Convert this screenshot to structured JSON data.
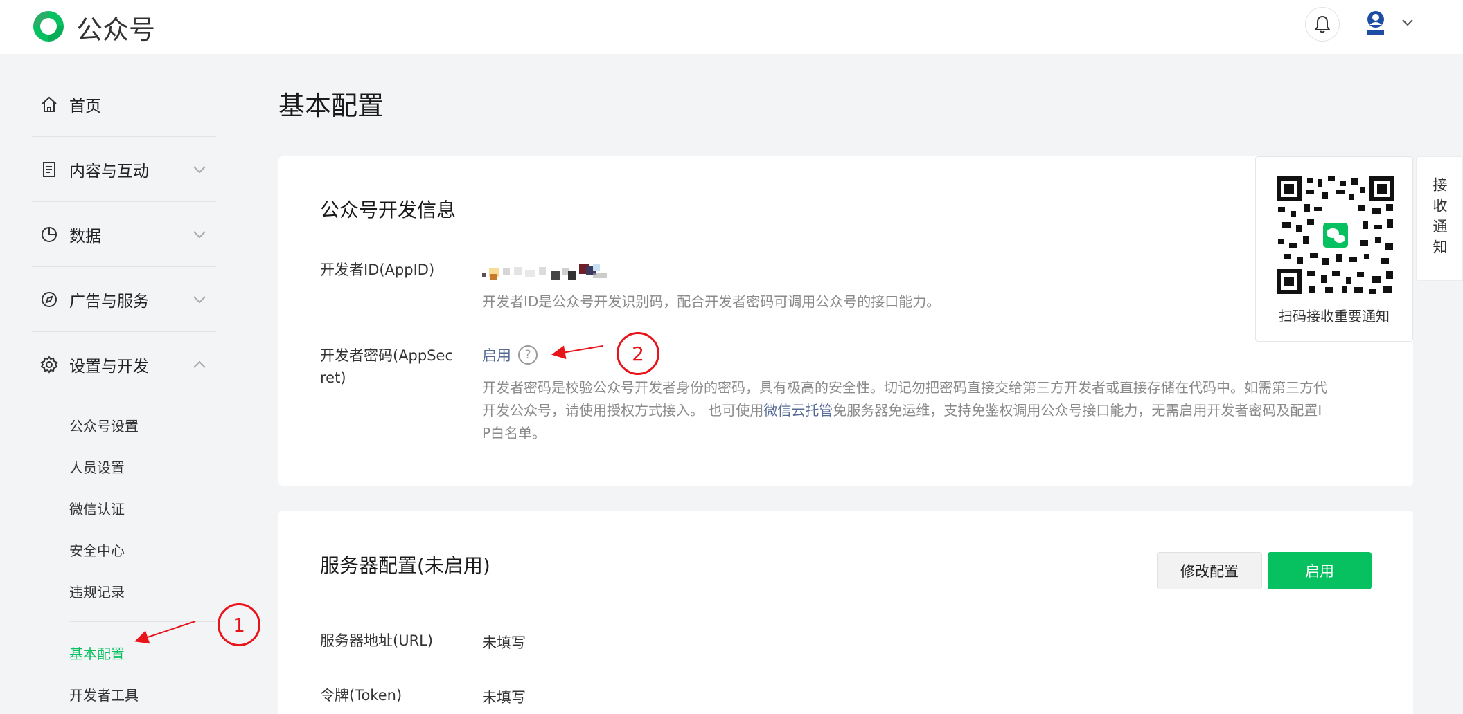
{
  "header": {
    "brand": "公众号",
    "icons": {
      "logo": "wechat-official-logo",
      "bell": "bell-icon",
      "avatar": "avatar",
      "caret": "chevron-down-icon"
    }
  },
  "sidebar": {
    "items": [
      {
        "label": "首页",
        "icon": "home-icon",
        "has_chevron": false
      },
      {
        "label": "内容与互动",
        "icon": "document-icon",
        "has_chevron": true
      },
      {
        "label": "数据",
        "icon": "chart-pie-icon",
        "has_chevron": true
      },
      {
        "label": "广告与服务",
        "icon": "compass-icon",
        "has_chevron": true
      },
      {
        "label": "设置与开发",
        "icon": "gear-icon",
        "has_chevron": true,
        "expanded": true
      }
    ],
    "sub_items": [
      {
        "label": "公众号设置"
      },
      {
        "label": "人员设置"
      },
      {
        "label": "微信认证"
      },
      {
        "label": "安全中心"
      },
      {
        "label": "违规记录"
      },
      {
        "label": "基本配置",
        "active": true
      },
      {
        "label": "开发者工具"
      }
    ]
  },
  "main": {
    "page_title": "基本配置",
    "dev_info": {
      "title": "公众号开发信息",
      "appid_label": "开发者ID(AppID)",
      "appid_desc": "开发者ID是公众号开发识别码，配合开发者密码可调用公众号的接口能力。",
      "secret_label_line1": "开发者密码(AppSec",
      "secret_label_line2": "ret)",
      "secret_action": "启用",
      "secret_help": "?",
      "secret_desc_line1": "开发者密码是校验公众号开发者身份的密码，具有极高的安全性。切记勿把密码直接交给第三方开发者或直接存储在代码中。如需第三方代",
      "secret_desc_line2_a": "开发公众号，请使用授权方式接入。 也可使用",
      "secret_desc_link": "微信云托管",
      "secret_desc_line2_b": "免服务器免运维，支持免鉴权调用公众号接口能力，无需启用开发者密码及配置I",
      "secret_desc_line3": "P白名单。"
    },
    "server": {
      "title": "服务器配置(未启用)",
      "modify_button": "修改配置",
      "enable_button": "启用",
      "url_label": "服务器地址(URL)",
      "url_value": "未填写",
      "token_label": "令牌(Token)",
      "token_value": "未填写"
    }
  },
  "qr_notice": {
    "text": "扫码接收重要通知",
    "tab_label": "接收通知"
  },
  "annotations": {
    "circle1": "1",
    "circle2": "2"
  },
  "colors": {
    "accent": "#07c160",
    "link": "#576b95",
    "annotation": "#e8141a"
  }
}
